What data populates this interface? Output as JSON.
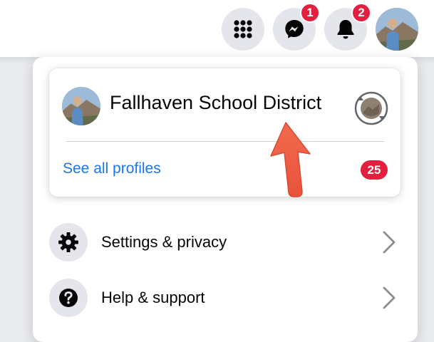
{
  "topbar": {
    "menu_icon": "grid-menu-icon",
    "messenger": {
      "icon": "messenger-icon",
      "badge": "1"
    },
    "notifications": {
      "icon": "bell-icon",
      "badge": "2"
    },
    "avatar": "profile-avatar"
  },
  "profile_card": {
    "name": "Fallhaven School District",
    "switch_icon": "switch-profile-icon",
    "see_all_label": "See all profiles",
    "profiles_count": "25"
  },
  "menu_items": [
    {
      "label": "Settings & privacy",
      "icon": "gear-icon"
    },
    {
      "label": "Help & support",
      "icon": "question-icon"
    }
  ],
  "colors": {
    "accent": "#1877f2",
    "badge": "#e41e3f",
    "annotation_arrow": "#f0654a"
  }
}
